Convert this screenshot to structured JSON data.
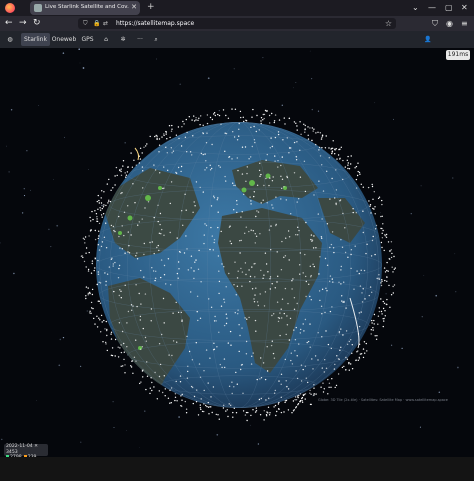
{
  "browser": {
    "tab_title": "Live Starlink Satellite and Cov...",
    "tab_close": "✕",
    "new_tab": "+",
    "url": "https://satellitemap.space",
    "window_controls": [
      "⌄",
      "—",
      "▢",
      "✕"
    ]
  },
  "app": {
    "items": [
      {
        "label": "Starlink",
        "active": true
      },
      {
        "label": "Oneweb",
        "active": false
      },
      {
        "label": "GPS",
        "active": false
      },
      {
        "label": "⌂",
        "active": false
      },
      {
        "label": "✲",
        "active": false
      },
      {
        "label": "···",
        "active": false
      },
      {
        "label": "⌕",
        "active": false
      }
    ],
    "ping": "191ms",
    "credit": "Globe: 3D Tile (2x-tile) · Satellites: Satellite Map · www.satellitemap.space",
    "stats": {
      "datetime": "2022-11-04",
      "count_label": "3453",
      "active": "2798",
      "other": "239"
    }
  },
  "colors": {
    "background": "#05070c",
    "ocean": "#2b5f8a",
    "land": "#3e4a45",
    "satellite": "#ffffff",
    "city_lights": "#6fdc4c"
  }
}
